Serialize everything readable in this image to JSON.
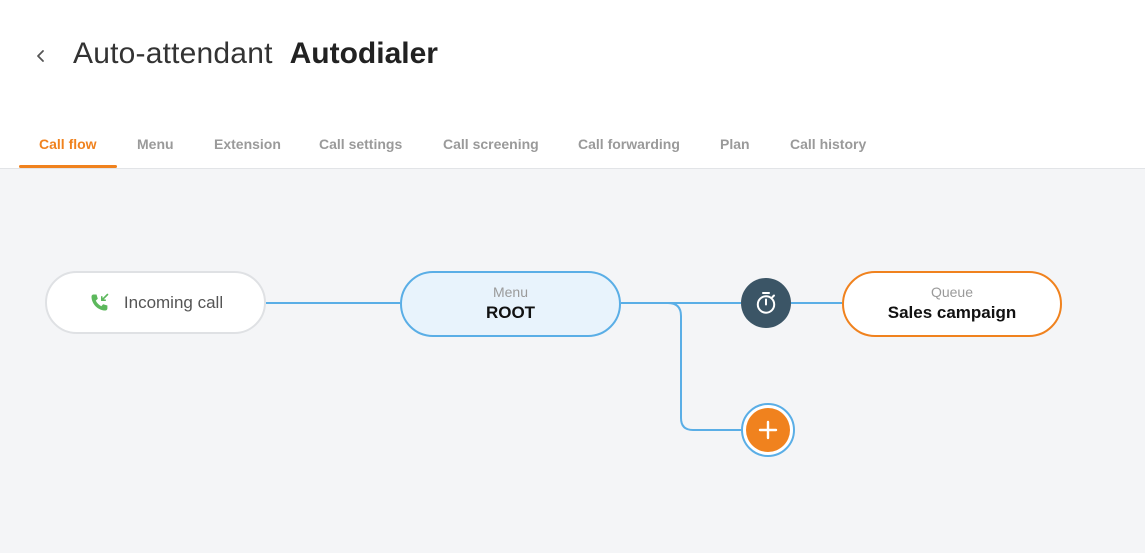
{
  "header": {
    "back_icon": "chevron-left-icon",
    "title_type": "Auto-attendant",
    "title_name": "Autodialer"
  },
  "tabs": [
    {
      "label": "Call flow",
      "active": true
    },
    {
      "label": "Menu",
      "active": false
    },
    {
      "label": "Extension",
      "active": false
    },
    {
      "label": "Call settings",
      "active": false
    },
    {
      "label": "Call screening",
      "active": false
    },
    {
      "label": "Call forwarding",
      "active": false
    },
    {
      "label": "Plan",
      "active": false
    },
    {
      "label": "Call history",
      "active": false
    }
  ],
  "flow": {
    "incoming": {
      "label": "Incoming call",
      "icon": "incoming-call-icon"
    },
    "menu": {
      "sublabel": "Menu",
      "label": "ROOT"
    },
    "timer": {
      "icon": "timer-icon"
    },
    "queue": {
      "sublabel": "Queue",
      "label": "Sales campaign"
    },
    "add": {
      "icon": "plus-icon"
    }
  },
  "colors": {
    "accent": "#f0821e",
    "connector": "#5aaee6",
    "menu_fill": "#e8f3fc",
    "timer_fill": "#3b5566",
    "canvas_bg": "#f4f5f7",
    "incoming_icon": "#5cb85c"
  }
}
